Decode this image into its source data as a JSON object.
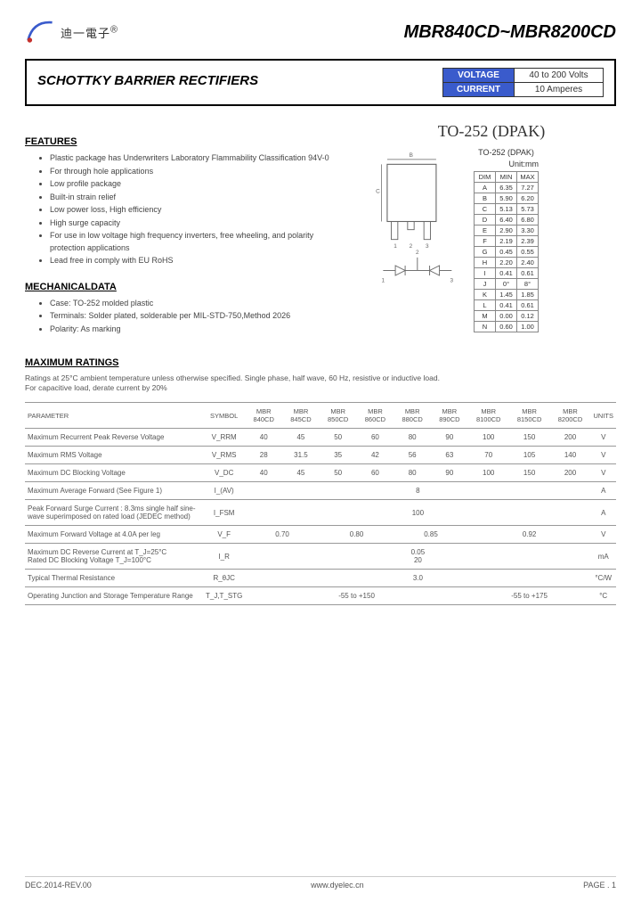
{
  "header": {
    "company_cn": "迪一電子",
    "trademark": "®",
    "part_range": "MBR840CD~MBR8200CD"
  },
  "title": "SCHOTTKY BARRIER RECTIFIERS",
  "spec_box": {
    "voltage_label": "VOLTAGE",
    "voltage_value": "40 to 200 Volts",
    "current_label": "CURRENT",
    "current_value": "10 Amperes"
  },
  "features": {
    "heading": "FEATURES",
    "items": [
      "Plastic package has Underwriters Laboratory Flammability Classification 94V-0",
      "For through hole applications",
      "Low profile package",
      "Built-in strain relief",
      "Low power loss, High efficiency",
      "High surge capacity",
      "For use in low voltage high frequency inverters, free wheeling, and polarity protection applications",
      "Lead free in comply with EU RoHS"
    ]
  },
  "mechanical": {
    "heading": "MECHANICALDATA",
    "items": [
      "Case: TO-252 molded plastic",
      "Terminals: Solder plated, solderable per MIL-STD-750,Method 2026",
      "Polarity: As marking"
    ]
  },
  "package": {
    "title": "TO-252 (DPAK)",
    "subtitle": "TO-252 (DPAK)",
    "unit_note": "Unit:mm",
    "headers": [
      "DIM",
      "MIN",
      "MAX"
    ],
    "rows": [
      [
        "A",
        "6.35",
        "7.27"
      ],
      [
        "B",
        "5.90",
        "6.20"
      ],
      [
        "C",
        "5.13",
        "5.73"
      ],
      [
        "D",
        "6.40",
        "6.80"
      ],
      [
        "E",
        "2.90",
        "3.30"
      ],
      [
        "F",
        "2.19",
        "2.39"
      ],
      [
        "G",
        "0.45",
        "0.55"
      ],
      [
        "H",
        "2.20",
        "2.40"
      ],
      [
        "I",
        "0.41",
        "0.61"
      ],
      [
        "J",
        "0°",
        "8°"
      ],
      [
        "K",
        "1.45",
        "1.85"
      ],
      [
        "L",
        "0.41",
        "0.61"
      ],
      [
        "M",
        "0.00",
        "0.12"
      ],
      [
        "N",
        "0.60",
        "1.00"
      ]
    ]
  },
  "max_ratings": {
    "heading": "MAXIMUM RATINGS",
    "note1": "Ratings at 25°C ambient temperature unless otherwise specified. Single phase, half wave, 60 Hz, resistive or inductive load.",
    "note2": "For capacitive load, derate current by 20%",
    "headers": [
      "PARAMETER",
      "SYMBOL",
      "MBR 840CD",
      "MBR 845CD",
      "MBR 850CD",
      "MBR 860CD",
      "MBR 880CD",
      "MBR 890CD",
      "MBR 8100CD",
      "MBR 8150CD",
      "MBR 8200CD",
      "UNITS"
    ],
    "rows": [
      {
        "param": "Maximum Recurrent Peak Reverse Voltage",
        "symbol": "V_RRM",
        "vals": [
          "40",
          "45",
          "50",
          "60",
          "80",
          "90",
          "100",
          "150",
          "200"
        ],
        "unit": "V"
      },
      {
        "param": "Maximum RMS Voltage",
        "symbol": "V_RMS",
        "vals": [
          "28",
          "31.5",
          "35",
          "42",
          "56",
          "63",
          "70",
          "105",
          "140"
        ],
        "unit": "V"
      },
      {
        "param": "Maximum DC Blocking Voltage",
        "symbol": "V_DC",
        "vals": [
          "40",
          "45",
          "50",
          "60",
          "80",
          "90",
          "100",
          "150",
          "200"
        ],
        "unit": "V"
      },
      {
        "param": "Maximum Average Forward (See Figure 1)",
        "symbol": "I_(AV)",
        "vals_span": "8",
        "unit": "A"
      },
      {
        "param": "Peak Forward Surge Current : 8.3ms single half sine-wave superimposed on rated load (JEDEC method)",
        "symbol": "I_FSM",
        "vals_span": "100",
        "unit": "A"
      },
      {
        "param": "Maximum Forward Voltage at 4.0A per leg",
        "symbol": "V_F",
        "vals_group": [
          "0.70",
          "0.80",
          "0.85",
          "0.92"
        ],
        "unit": "V"
      },
      {
        "param": "Maximum DC Reverse Current at T_J=25°C\nRated DC Blocking Voltage T_J=100°C",
        "symbol": "I_R",
        "vals_span": "0.05\n20",
        "unit": "mA"
      },
      {
        "param": "Typical Thermal Resistance",
        "symbol": "R_θJC",
        "vals_span": "3.0",
        "unit": "°C/W"
      },
      {
        "param": "Operating Junction and Storage Temperature Range",
        "symbol": "T_J,T_STG",
        "vals_group2": [
          "-55 to +150",
          "-55 to +175"
        ],
        "unit": "°C"
      }
    ]
  },
  "footer": {
    "left": "DEC.2014-REV.00",
    "center": "www.dyelec.cn",
    "right": "PAGE . 1"
  },
  "chart_data": {
    "type": "table",
    "title": "Maximum Ratings – MBR840CD~MBR8200CD",
    "columns": [
      "Parameter",
      "Symbol",
      "MBR840CD",
      "MBR845CD",
      "MBR850CD",
      "MBR860CD",
      "MBR880CD",
      "MBR890CD",
      "MBR8100CD",
      "MBR8150CD",
      "MBR8200CD",
      "Units"
    ],
    "rows": [
      [
        "Maximum Recurrent Peak Reverse Voltage",
        "VRRM",
        40,
        45,
        50,
        60,
        80,
        90,
        100,
        150,
        200,
        "V"
      ],
      [
        "Maximum RMS Voltage",
        "VRMS",
        28,
        31.5,
        35,
        42,
        56,
        63,
        70,
        105,
        140,
        "V"
      ],
      [
        "Maximum DC Blocking Voltage",
        "VDC",
        40,
        45,
        50,
        60,
        80,
        90,
        100,
        150,
        200,
        "V"
      ],
      [
        "Maximum Average Forward",
        "I(AV)",
        8,
        8,
        8,
        8,
        8,
        8,
        8,
        8,
        8,
        "A"
      ],
      [
        "Peak Forward Surge Current",
        "IFSM",
        100,
        100,
        100,
        100,
        100,
        100,
        100,
        100,
        100,
        "A"
      ],
      [
        "Maximum Forward Voltage at 4.0A per leg",
        "VF",
        0.7,
        0.7,
        0.8,
        0.8,
        0.85,
        0.85,
        0.92,
        0.92,
        0.92,
        "V"
      ],
      [
        "Max DC Reverse Current TJ=25°C",
        "IR",
        0.05,
        0.05,
        0.05,
        0.05,
        0.05,
        0.05,
        0.05,
        0.05,
        0.05,
        "mA"
      ],
      [
        "Max DC Reverse Current TJ=100°C",
        "IR",
        20,
        20,
        20,
        20,
        20,
        20,
        20,
        20,
        20,
        "mA"
      ],
      [
        "Typical Thermal Resistance",
        "RθJC",
        3.0,
        3.0,
        3.0,
        3.0,
        3.0,
        3.0,
        3.0,
        3.0,
        3.0,
        "°C/W"
      ],
      [
        "Operating/Storage Temp Range",
        "TJ,TSTG",
        "-55 to +150",
        "-55 to +150",
        "-55 to +150",
        "-55 to +150",
        "-55 to +150",
        "-55 to +150",
        "-55 to +175",
        "-55 to +175",
        "-55 to +175",
        "°C"
      ]
    ]
  }
}
